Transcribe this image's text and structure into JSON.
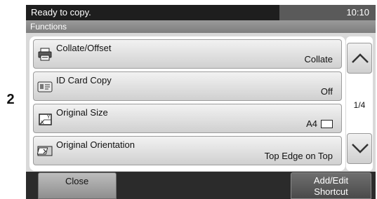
{
  "callout_number": "2",
  "status": {
    "message": "Ready to copy.",
    "time": "10:10"
  },
  "panel": {
    "title": "Functions"
  },
  "functions": [
    {
      "label": "Collate/Offset",
      "value": "Collate",
      "icon": "collate-icon"
    },
    {
      "label": "ID Card Copy",
      "value": "Off",
      "icon": "id-card-icon"
    },
    {
      "label": "Original Size",
      "value": "A4",
      "icon": "original-size-icon",
      "value_icon": "paper-landscape-icon"
    },
    {
      "label": "Original Orientation",
      "value": "Top Edge on Top",
      "icon": "orientation-icon"
    }
  ],
  "pagination": {
    "indicator": "1/4",
    "up_icon": "chevron-up-icon",
    "down_icon": "chevron-down-icon"
  },
  "footer": {
    "close_label": "Close",
    "shortcut_line1": "Add/Edit",
    "shortcut_line2": "Shortcut"
  }
}
